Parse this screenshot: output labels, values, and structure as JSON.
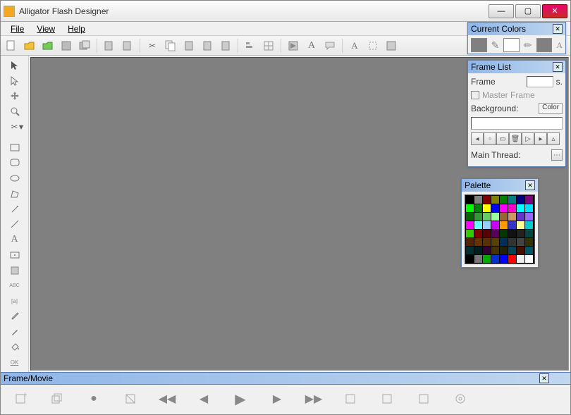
{
  "window": {
    "title": "Alligator Flash Designer",
    "min": "—",
    "max": "▢",
    "close": "✕"
  },
  "menu": {
    "file": "File",
    "view": "View",
    "help": "Help"
  },
  "toolbar_icons": {
    "new": "new",
    "open": "open",
    "open2": "open-green",
    "save": "save",
    "saveas": "saveas",
    "export": "export",
    "publish": "publish",
    "cut": "cut",
    "copy": "copy",
    "paste": "paste",
    "paste2": "paste2",
    "undo": "undo",
    "align": "align",
    "grid": "grid",
    "preview": "preview",
    "text": "A",
    "comment": "comment",
    "textfx": "Aᵢ",
    "select": "select",
    "grab": "grab"
  },
  "tools": [
    "pointer",
    "direct",
    "drag",
    "zoom",
    "scissors",
    "rect",
    "roundrect",
    "ellipse",
    "polygon",
    "wand",
    "line",
    "text",
    "button",
    "sprite",
    "abc",
    "rename",
    "eyedrop",
    "pen",
    "paintbucket",
    "ok"
  ],
  "panels": {
    "colors": {
      "title": "Current Colors",
      "fill_icon": "fill",
      "line_icon": "line",
      "text_icon": "A"
    },
    "framelist": {
      "title": "Frame List",
      "frame_label": "Frame",
      "s_label": "s.",
      "master_label": "Master Frame",
      "background_label": "Background:",
      "color_btn": "Color",
      "mainthread_label": "Main Thread:",
      "btns": [
        "first",
        "back",
        "stop",
        "del",
        "play",
        "last"
      ]
    },
    "palette": {
      "title": "Palette",
      "colors": [
        "#000000",
        "#808080",
        "#800000",
        "#808000",
        "#008000",
        "#008080",
        "#000080",
        "#800080",
        "#00ff00",
        "#008000",
        "#ffff00",
        "#0000ff",
        "#ff00ff",
        "#ff00cc",
        "#00ffff",
        "#00ddff",
        "#006600",
        "#339933",
        "#66cc66",
        "#99ff99",
        "#996633",
        "#cc9966",
        "#6633cc",
        "#9966ff",
        "#ff00ff",
        "#66ffff",
        "#99ccff",
        "#cc00ff",
        "#ff9900",
        "#3333cc",
        "#ffff99",
        "#00cccc",
        "#33cc00",
        "#800000",
        "#590000",
        "#590059",
        "#003800",
        "#111111",
        "#222222",
        "#004444",
        "#552200",
        "#663300",
        "#593000",
        "#594000",
        "#003059",
        "#333333",
        "#444444",
        "#333300",
        "#003030",
        "#002020",
        "#330033",
        "#443300",
        "#222200",
        "#004455",
        "#441100",
        "#005566",
        "#000000",
        "#777777",
        "#00aa00",
        "#0033cc",
        "#0000ff",
        "#ff0000",
        "#eeeeee",
        "#ffffff"
      ]
    }
  },
  "timeline": {
    "title": "Frame/Movie",
    "btns": [
      "addframe",
      "addlayer",
      "circle",
      "cut",
      "first",
      "prev",
      "play",
      "next",
      "last",
      "loop",
      "props",
      "export",
      "target"
    ]
  }
}
